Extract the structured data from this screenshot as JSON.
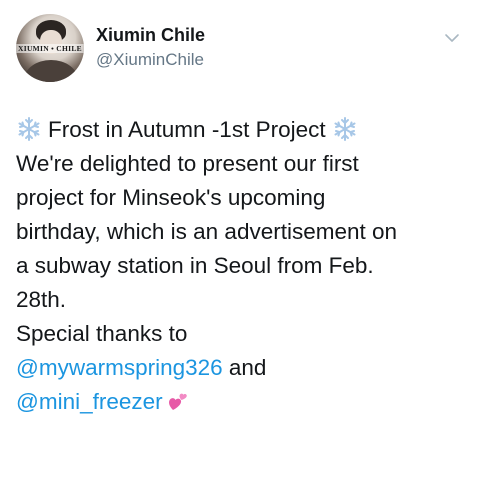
{
  "author": {
    "display_name": "Xiumin Chile",
    "handle": "@XiuminChile",
    "avatar_text": "XIUMIN • CHILE"
  },
  "menu_icon": "chevron-down-icon",
  "tweet": {
    "title": "Frost in Autumn -1st Project",
    "title_icon": "snowflake-icon",
    "body_lines": [
      "We're delighted to present our first",
      "project for Minseok's upcoming",
      "birthday, which is an advertisement on",
      "a subway station in Seoul from Feb.",
      "28th.",
      "Special thanks to"
    ],
    "mention_1": "@mywarmspring326",
    "conjunction": " and",
    "mention_2": "@mini_freezer",
    "end_icon": "two-hearts-icon"
  },
  "colors": {
    "text": "#14171a",
    "secondary": "#657786",
    "link": "#1b95e0",
    "snowflake": "#a7c7e7",
    "heart": "#e75aa7"
  }
}
